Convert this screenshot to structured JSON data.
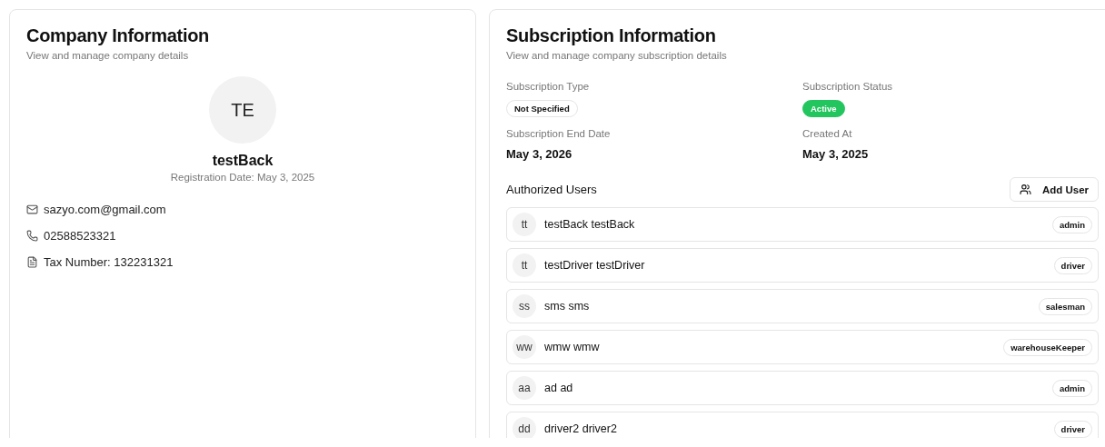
{
  "company": {
    "title": "Company Information",
    "subtitle": "View and manage company details",
    "avatar": "TE",
    "name": "testBack",
    "registration": "Registration Date: May 3, 2025",
    "contacts": [
      {
        "kind": "email",
        "text": "sazyo.com@gmail.com"
      },
      {
        "kind": "phone",
        "text": "02588523321"
      },
      {
        "kind": "document",
        "text": "Tax Number: 132231321"
      }
    ]
  },
  "subscription": {
    "title": "Subscription Information",
    "subtitle": "View and manage company subscription details",
    "fields": [
      {
        "label": "Subscription Type",
        "kind": "tag",
        "value": "Not Specified"
      },
      {
        "label": "Subscription Status",
        "kind": "status",
        "value": "Active"
      },
      {
        "label": "Subscription End Date",
        "kind": "text",
        "value": "May 3, 2026"
      },
      {
        "label": "Created At",
        "kind": "text",
        "value": "May 3, 2025"
      }
    ],
    "users_title": "Authorized Users",
    "add_button": "Add User",
    "users": [
      {
        "initials": "tt",
        "name": "testBack testBack",
        "role": "admin"
      },
      {
        "initials": "tt",
        "name": "testDriver testDriver",
        "role": "driver"
      },
      {
        "initials": "ss",
        "name": "sms sms",
        "role": "salesman"
      },
      {
        "initials": "ww",
        "name": "wmw wmw",
        "role": "warehouseKeeper"
      },
      {
        "initials": "aa",
        "name": "ad ad",
        "role": "admin"
      },
      {
        "initials": "dd",
        "name": "driver2 driver2",
        "role": "driver"
      }
    ]
  }
}
